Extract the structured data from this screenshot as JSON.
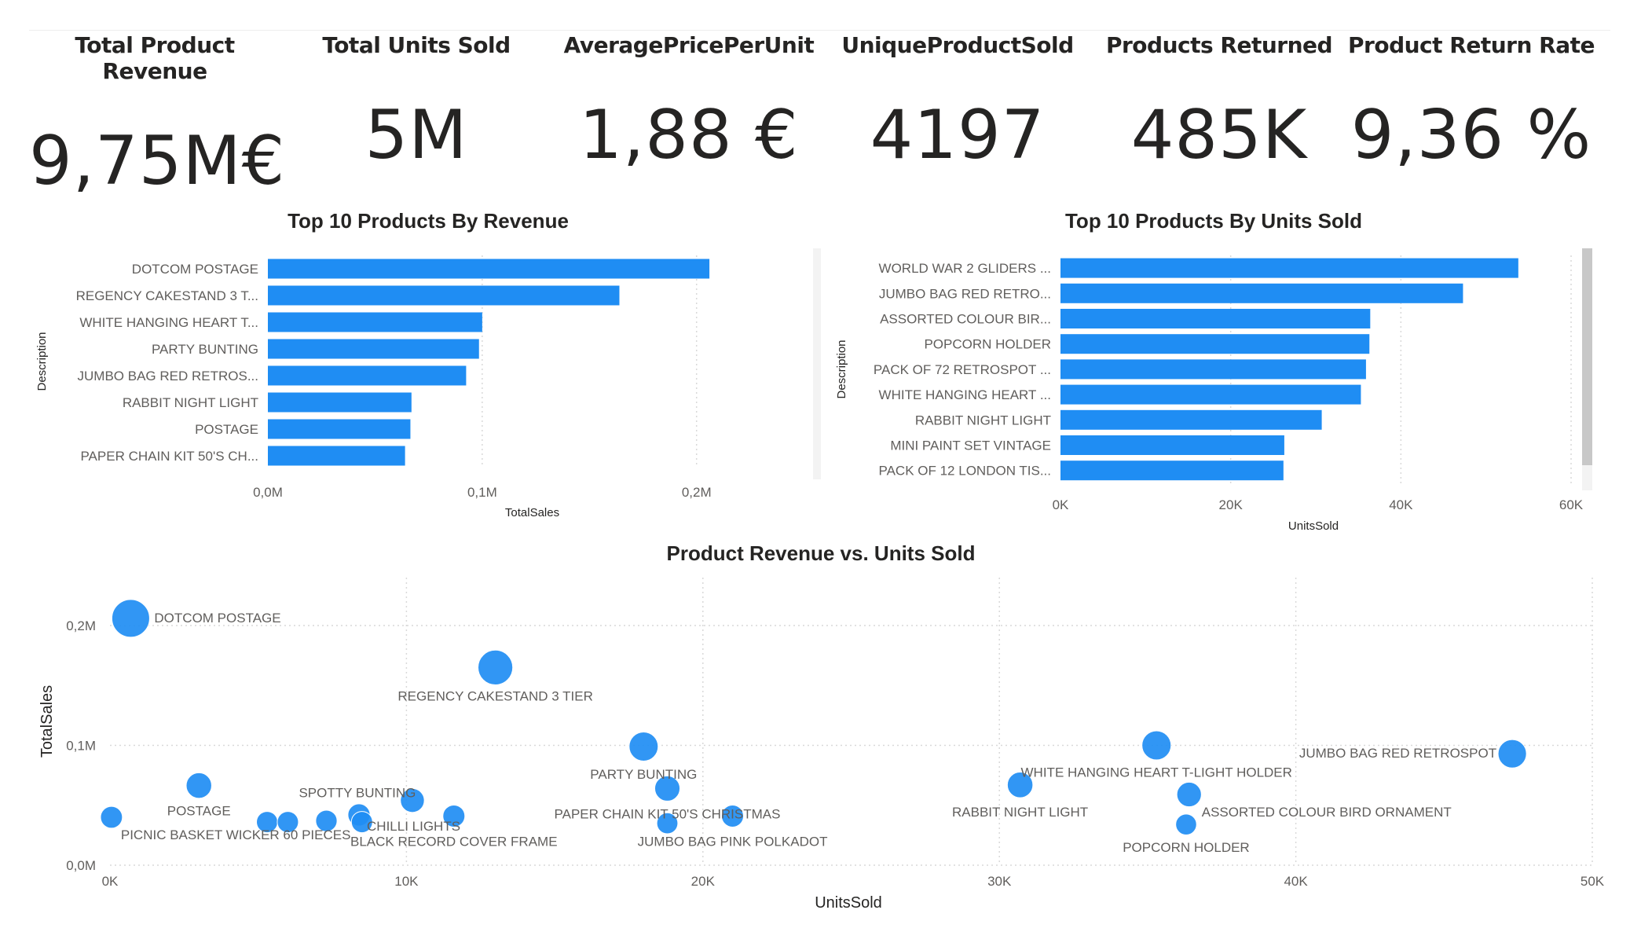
{
  "kpis": [
    {
      "title": "Total Product Revenue",
      "value": "9,75M€"
    },
    {
      "title": "Total Units Sold",
      "value": "5M"
    },
    {
      "title": "AveragePricePerUnit",
      "value": "1,88 €"
    },
    {
      "title": "UniqueProductSold",
      "value": "4197"
    },
    {
      "title": "Products Returned",
      "value": "485K"
    },
    {
      "title": "Product Return Rate",
      "value": "9,36 %"
    }
  ],
  "colors": {
    "bar": "#1f8df3",
    "bubble": "#1f8df3",
    "text": "#252423",
    "axis_text": "#605e5c",
    "grid": "#d9d9d9"
  },
  "chart_data": [
    {
      "type": "bar",
      "orientation": "horizontal",
      "title": "Top 10 Products By Revenue",
      "xlabel": "TotalSales",
      "ylabel": "Description",
      "xlim": [
        0,
        210000
      ],
      "xticks": [
        0,
        100000,
        200000
      ],
      "xtick_labels": [
        "0,0M",
        "0,1M",
        "0,2M"
      ],
      "categories": [
        "DOTCOM POSTAGE",
        "REGENCY CAKESTAND 3 T...",
        "WHITE HANGING HEART T...",
        "PARTY BUNTING",
        "JUMBO BAG RED RETROS...",
        "RABBIT NIGHT LIGHT",
        "POSTAGE",
        "PAPER CHAIN KIT 50'S CH..."
      ],
      "values": [
        206000,
        164000,
        100000,
        98500,
        92500,
        67000,
        66500,
        64000
      ],
      "grid": true
    },
    {
      "type": "bar",
      "orientation": "horizontal",
      "title": "Top 10 Products By Units Sold",
      "xlabel": "UnitsSold",
      "ylabel": "Description",
      "xlim": [
        0,
        60000
      ],
      "xticks": [
        0,
        20000,
        40000,
        60000
      ],
      "xtick_labels": [
        "0K",
        "20K",
        "40K",
        "60K"
      ],
      "categories": [
        "WORLD WAR 2 GLIDERS ...",
        "JUMBO BAG RED RETRO...",
        "ASSORTED COLOUR BIR...",
        "POPCORN HOLDER",
        "PACK OF 72 RETROSPOT ...",
        "WHITE HANGING HEART ...",
        "RABBIT NIGHT LIGHT",
        "MINI PAINT SET VINTAGE",
        "PACK OF 12 LONDON TIS..."
      ],
      "values": [
        53800,
        47300,
        36400,
        36300,
        35900,
        35300,
        30700,
        26300,
        26200
      ],
      "grid": true
    },
    {
      "type": "scatter",
      "title": "Product Revenue vs. Units Sold",
      "xlabel": "UnitsSold",
      "ylabel": "TotalSales",
      "xlim": [
        0,
        50000
      ],
      "ylim": [
        0,
        240000
      ],
      "xticks": [
        0,
        10000,
        20000,
        30000,
        40000,
        50000
      ],
      "xtick_labels": [
        "0K",
        "10K",
        "20K",
        "30K",
        "40K",
        "50K"
      ],
      "yticks": [
        0,
        100000,
        200000
      ],
      "ytick_labels": [
        "0,0M",
        "0,1M",
        "0,2M"
      ],
      "grid": true,
      "points": [
        {
          "label": "DOTCOM POSTAGE",
          "x": 700,
          "y": 206000,
          "size": 206000
        },
        {
          "label": "REGENCY CAKESTAND 3 TIER",
          "x": 13000,
          "y": 165000,
          "size": 165000
        },
        {
          "label": "PARTY BUNTING",
          "x": 18000,
          "y": 99000,
          "size": 99000
        },
        {
          "label": "WHITE HANGING HEART T-LIGHT HOLDER",
          "x": 35300,
          "y": 100000,
          "size": 100000
        },
        {
          "label": "JUMBO BAG RED RETROSPOT",
          "x": 47300,
          "y": 93000,
          "size": 93000
        },
        {
          "label": "RABBIT NIGHT LIGHT",
          "x": 30700,
          "y": 67000,
          "size": 67000
        },
        {
          "label": "POSTAGE",
          "x": 3000,
          "y": 66500,
          "size": 66500
        },
        {
          "label": "PAPER CHAIN KIT 50'S CHRISTMAS",
          "x": 18800,
          "y": 64000,
          "size": 64000
        },
        {
          "label": "ASSORTED COLOUR BIRD ORNAMENT",
          "x": 36400,
          "y": 59000,
          "size": 59000
        },
        {
          "label": "SPOTTY BUNTING",
          "x": 10200,
          "y": 54000,
          "size": 54000
        },
        {
          "label": "PICNIC BASKET WICKER 60 PIECES",
          "x": 50,
          "y": 40000,
          "size": 40000
        },
        {
          "label": "CHILLI LIGHTS",
          "x": 8400,
          "y": 42000,
          "size": 42000
        },
        {
          "label": "BLACK RECORD COVER FRAME",
          "x": 11600,
          "y": 41000,
          "size": 41000
        },
        {
          "label": "JUMBO BAG PINK POLKADOT",
          "x": 21000,
          "y": 41000,
          "size": 41000
        },
        {
          "label": "POPCORN HOLDER",
          "x": 36300,
          "y": 34000,
          "size": 34000
        },
        {
          "label": "",
          "x": 5300,
          "y": 36000,
          "size": 36000
        },
        {
          "label": "",
          "x": 6000,
          "y": 36000,
          "size": 36000
        },
        {
          "label": "",
          "x": 7300,
          "y": 37000,
          "size": 37000
        },
        {
          "label": "",
          "x": 8500,
          "y": 36000,
          "size": 36000
        },
        {
          "label": "",
          "x": 18800,
          "y": 35000,
          "size": 35000
        }
      ]
    }
  ]
}
